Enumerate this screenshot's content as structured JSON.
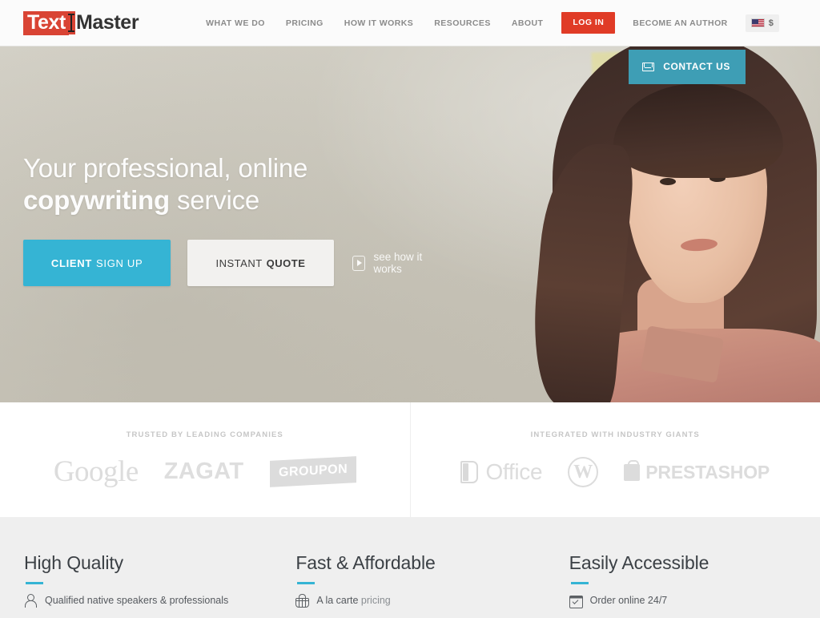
{
  "header": {
    "logo": {
      "part1": "Text",
      "part2": "Master",
      "cursor_icon": "text-cursor-icon"
    },
    "nav": [
      {
        "label": "WHAT WE DO"
      },
      {
        "label": "PRICING"
      },
      {
        "label": "HOW IT WORKS"
      },
      {
        "label": "RESOURCES"
      },
      {
        "label": "ABOUT"
      }
    ],
    "login_label": "LOG IN",
    "author_label": "BECOME AN AUTHOR",
    "locale": {
      "flag": "us-flag-icon",
      "currency": "$"
    },
    "accent_red": "#e03b26"
  },
  "hero": {
    "contact_label": "CONTACT US",
    "contact_icon": "envelope-icon",
    "headline_line1": "Your professional, online",
    "headline_line2_bold": "copywriting",
    "headline_line2_rest": " service",
    "primary_button": {
      "bold": "CLIENT",
      "rest": "SIGN UP"
    },
    "secondary_button": {
      "rest": "INSTANT",
      "bold": "QUOTE"
    },
    "video_link_label": "see how it works",
    "video_icon": "play-icon",
    "accent_blue": "#35b4d4"
  },
  "partners": {
    "left": {
      "title": "TRUSTED BY LEADING COMPANIES",
      "logos": [
        {
          "name": "google-logo",
          "label": "Google"
        },
        {
          "name": "zagat-logo",
          "label": "ZAGAT"
        },
        {
          "name": "groupon-logo",
          "label": "GROUPON"
        }
      ]
    },
    "right": {
      "title": "INTEGRATED WITH INDUSTRY GIANTS",
      "logos": [
        {
          "name": "office-logo",
          "label": "Office"
        },
        {
          "name": "wordpress-logo",
          "label": "W"
        },
        {
          "name": "prestashop-logo",
          "label": "PRESTASHOP"
        }
      ]
    }
  },
  "features": [
    {
      "title": "High Quality",
      "icon": "person-icon",
      "text": "Qualified native speakers & professionals"
    },
    {
      "title": "Fast & Affordable",
      "icon": "basket-icon",
      "text_bold": "A la carte",
      "text_muted": " pricing"
    },
    {
      "title": "Easily Accessible",
      "icon": "calendar-icon",
      "text": "Order online 24/7"
    }
  ]
}
